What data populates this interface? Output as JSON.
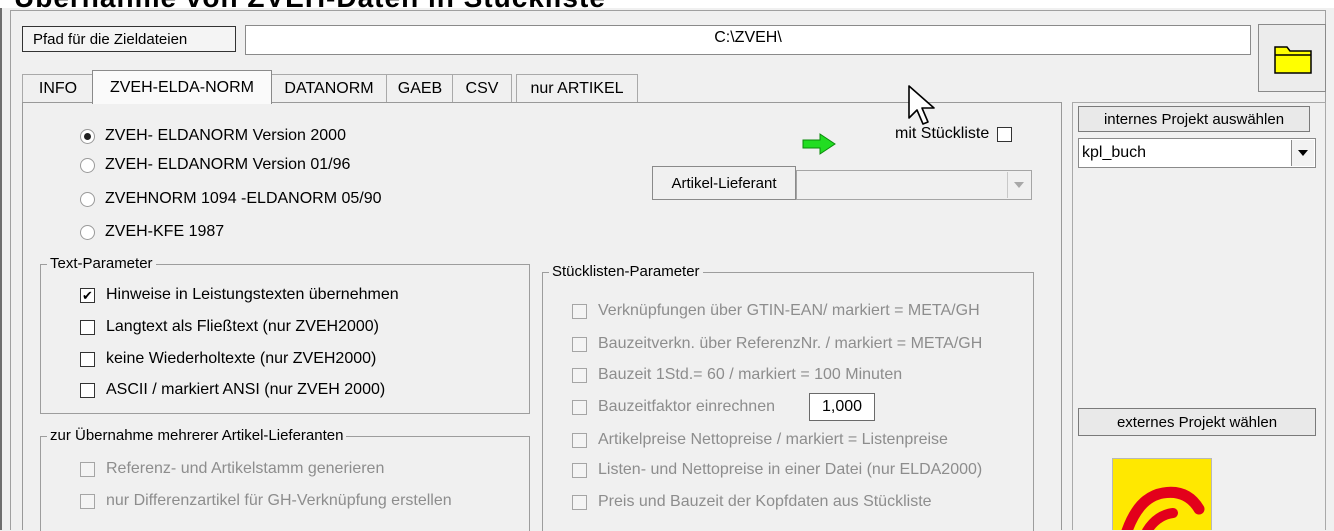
{
  "window": {
    "title": "Übernahme von ZVEH-Daten in Stückliste"
  },
  "path": {
    "label": "Pfad für die Zieldateien",
    "value": "C:\\ZVEH\\"
  },
  "tabs": [
    "INFO",
    "ZVEH-ELDA-NORM",
    "DATANORM",
    "GAEB",
    "CSV",
    "nur ARTIKEL"
  ],
  "versions": [
    {
      "label": "ZVEH- ELDANORM Version 2000",
      "selected": true
    },
    {
      "label": "ZVEH- ELDANORM Version 01/96",
      "selected": false
    },
    {
      "label": "ZVEHNORM 1094 -ELDANORM 05/90",
      "selected": false
    },
    {
      "label": "ZVEH-KFE 1987",
      "selected": false
    }
  ],
  "stueckliste_checkbox": {
    "label": "mit Stückliste",
    "checked": false
  },
  "lieferant": {
    "label": "Artikel-Lieferant",
    "value": ""
  },
  "text_params": {
    "title": "Text-Parameter",
    "items": [
      {
        "label": "Hinweise in Leistungstexten übernehmen",
        "checked": true
      },
      {
        "label": "Langtext als Fließtext (nur ZVEH2000)",
        "checked": false
      },
      {
        "label": "keine Wiederholtexte (nur ZVEH2000)",
        "checked": false
      },
      {
        "label": "ASCII / markiert ANSI (nur ZVEH 2000)",
        "checked": false
      }
    ]
  },
  "multi_supplier": {
    "title": "zur Übernahme mehrerer Artikel-Lieferanten",
    "items": [
      {
        "label": "Referenz- und Artikelstamm generieren",
        "checked": false
      },
      {
        "label": "nur Differenzartikel für GH-Verknüpfung erstellen",
        "checked": false
      }
    ]
  },
  "stl_params": {
    "title": "Stücklisten-Parameter",
    "items": [
      {
        "label": "Verknüpfungen über GTIN-EAN/ markiert = META/GH",
        "checked": false
      },
      {
        "label": "Bauzeitverkn. über ReferenzNr. / markiert = META/GH",
        "checked": false
      },
      {
        "label": "Bauzeit 1Std.= 60 / markiert = 100 Minuten",
        "checked": false
      },
      {
        "label": "Bauzeitfaktor einrechnen",
        "checked": false
      },
      {
        "label": "Artikelpreise  Nettopreise / markiert = Listenpreise",
        "checked": false
      },
      {
        "label": "Listen- und Nettopreise in einer Datei (nur ELDA2000)",
        "checked": false
      },
      {
        "label": "Preis und Bauzeit der Kopfdaten aus Stückliste",
        "checked": false
      }
    ],
    "factor_value": "1,000"
  },
  "project": {
    "internal_button": "internes Projekt auswählen",
    "internal_value": "kpl_buch",
    "external_button": "externes Projekt wählen"
  },
  "colors": {
    "arrow": "#22dd22",
    "folder": "#ffff00",
    "logo_bg": "#ffe800",
    "logo_red": "#e3001b"
  }
}
